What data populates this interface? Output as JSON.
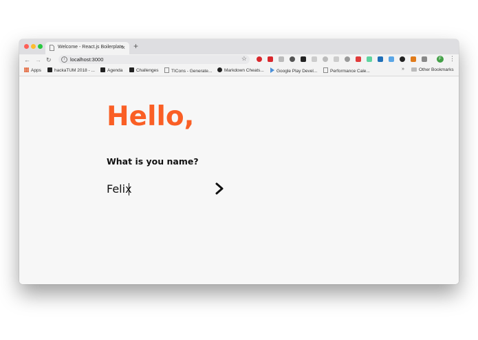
{
  "browser": {
    "tab_title": "Welcome - React.js Boilerplate",
    "tab_close": "×",
    "new_tab": "+",
    "url": "localhost:3000",
    "star": "☆",
    "profile_initial": "F",
    "menu": "⋮",
    "nav": {
      "back": "←",
      "forward": "→",
      "reload": "↻"
    }
  },
  "bookmarks": {
    "items": [
      {
        "label": "Apps",
        "icon": "apps-grid-icon"
      },
      {
        "label": "hackaTUM 2018 - ...",
        "icon": "notion-icon"
      },
      {
        "label": "Agenda",
        "icon": "notion-icon"
      },
      {
        "label": "Challenges",
        "icon": "notion-icon"
      },
      {
        "label": "TICons - Generate...",
        "icon": "page-icon"
      },
      {
        "label": "Markdown Cheats...",
        "icon": "github-icon"
      },
      {
        "label": "Google Play Devel...",
        "icon": "google-play-icon"
      },
      {
        "label": "Performance Cale...",
        "icon": "page-icon"
      }
    ],
    "more": "»",
    "other": "Other Bookmarks"
  },
  "page": {
    "heading": "Hello,",
    "question": "What is you name?",
    "name_value": "Felix",
    "submit_icon": "chevron-right-icon",
    "accent_color": "#fa5f25"
  }
}
